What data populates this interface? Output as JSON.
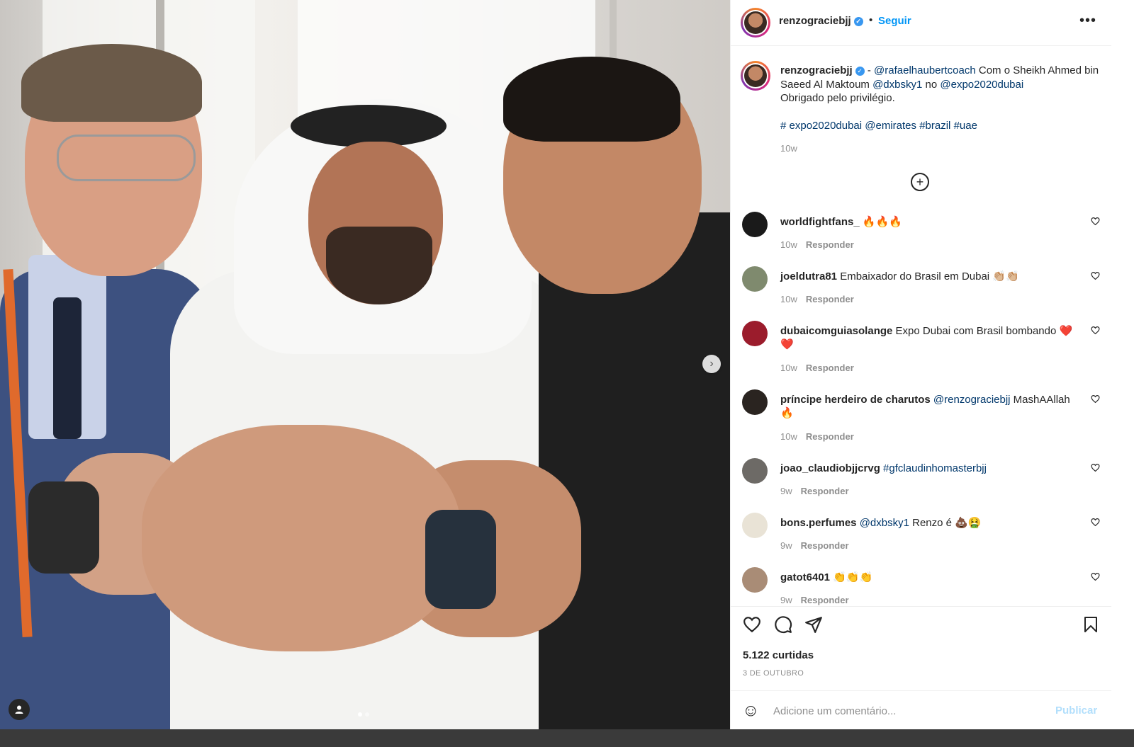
{
  "post": {
    "username": "renzograciebjj",
    "follow_label": "Seguir",
    "separator": "•",
    "more_label": "•••",
    "caption": {
      "username": "renzograciebjj",
      "dash": " - ",
      "mention1": "@rafaelhaubertcoach",
      "text1": " Com o Sheikh Ahmed bin Saeed Al Maktoum ",
      "mention2": "@dxbsky1",
      "text2": " no ",
      "mention3": "@expo2020dubai",
      "text3": "Obrigado pelo privilégio.",
      "tag1": "# expo2020dubai",
      "tag2": "@emirates",
      "tag3": "#brazil",
      "tag4": "#uae",
      "time": "10w"
    },
    "load_more_label": "+",
    "next_label": "›",
    "likes": "5.122 curtidas",
    "date": "3 DE OUTUBRO",
    "comment_placeholder": "Adicione um comentário...",
    "publish_label": "Publicar",
    "emoji_label": "☺"
  },
  "comments": [
    {
      "user": "worldfightfans_",
      "parts": [
        {
          "t": "🔥🔥🔥",
          "link": false
        }
      ],
      "time": "10w",
      "reply": "Responder",
      "avatar_color": "#1a1a1a"
    },
    {
      "user": "joeldutra81",
      "parts": [
        {
          "t": "Embaixador do Brasil em Dubai 👏🏼👏🏼",
          "link": false
        }
      ],
      "time": "10w",
      "reply": "Responder",
      "avatar_color": "#7f8a6e"
    },
    {
      "user": "dubaicomguiasolange",
      "parts": [
        {
          "t": "Expo Dubai com Brasil bombando ❤️❤️",
          "link": false
        }
      ],
      "time": "10w",
      "reply": "Responder",
      "avatar_color": "#9b1c2c"
    },
    {
      "user": "príncipe herdeiro de charutos",
      "parts": [
        {
          "t": "@renzograciebjj",
          "link": true
        },
        {
          "t": " MashAAllah 🔥",
          "link": false
        }
      ],
      "time": "10w",
      "reply": "Responder",
      "avatar_color": "#2a2420"
    },
    {
      "user": "joao_claudiobjjcrvg",
      "parts": [
        {
          "t": "#gfclaudinhomasterbjj",
          "link": true
        }
      ],
      "time": "9w",
      "reply": "Responder",
      "avatar_color": "#6d6a66"
    },
    {
      "user": "bons.perfumes",
      "parts": [
        {
          "t": "@dxbsky1",
          "link": true
        },
        {
          "t": " Renzo é 💩🤮",
          "link": false
        }
      ],
      "time": "9w",
      "reply": "Responder",
      "avatar_color": "#e9e3d6"
    },
    {
      "user": "gatot6401",
      "parts": [
        {
          "t": "👏👏👏",
          "link": false
        }
      ],
      "time": "9w",
      "reply": "Responder",
      "avatar_color": "#a98c76"
    }
  ]
}
